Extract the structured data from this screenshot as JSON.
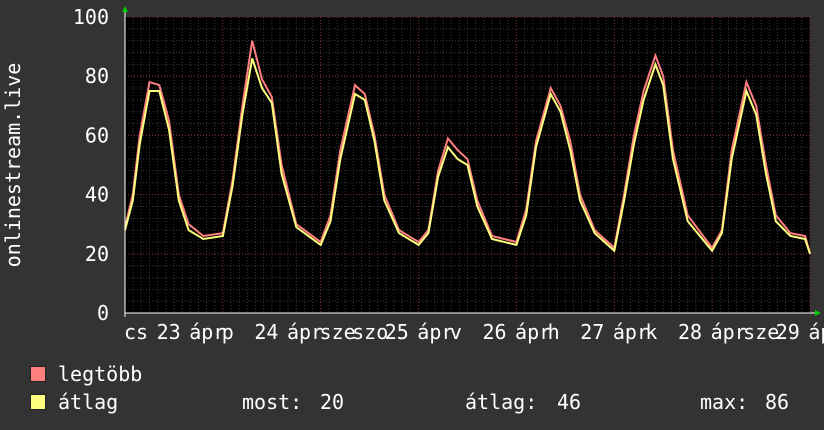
{
  "chart_data": {
    "type": "line",
    "ylabel": "onlinestream.live",
    "ylim": [
      0,
      100
    ],
    "yticks": [
      0,
      20,
      40,
      60,
      80,
      100
    ],
    "xlim": [
      0,
      7
    ],
    "xtick_labels": [
      "cs",
      "23",
      "ápr",
      "p",
      "24",
      "ápr",
      "sze",
      "szo",
      "25",
      "ápr",
      "v",
      "26",
      "ápr",
      "h",
      "27",
      "ápr",
      "k",
      "28",
      "ápr",
      "sze",
      "29",
      "ápr"
    ],
    "background": "#000000",
    "grid": true,
    "legend_position": "bottom-left",
    "series": [
      {
        "name": "legtöbb",
        "color": "#ff7f7f",
        "x": [
          0,
          0.08,
          0.15,
          0.25,
          0.35,
          0.45,
          0.55,
          0.65,
          0.8,
          1.0,
          1.1,
          1.2,
          1.3,
          1.4,
          1.5,
          1.6,
          1.75,
          2.0,
          2.1,
          2.2,
          2.35,
          2.45,
          2.55,
          2.65,
          2.8,
          3.0,
          3.1,
          3.2,
          3.3,
          3.4,
          3.5,
          3.6,
          3.75,
          4.0,
          4.1,
          4.2,
          4.35,
          4.45,
          4.55,
          4.65,
          4.8,
          5.0,
          5.1,
          5.2,
          5.3,
          5.42,
          5.5,
          5.6,
          5.75,
          6.0,
          6.1,
          6.2,
          6.35,
          6.45,
          6.55,
          6.65,
          6.8,
          6.95,
          7.0
        ],
        "values": [
          29,
          40,
          60,
          78,
          77,
          65,
          40,
          30,
          26,
          27,
          45,
          70,
          92,
          79,
          73,
          50,
          30,
          24,
          33,
          55,
          77,
          74,
          60,
          40,
          28,
          24,
          28,
          48,
          59,
          55,
          52,
          38,
          26,
          24,
          35,
          58,
          76,
          70,
          58,
          40,
          28,
          22,
          40,
          60,
          75,
          87,
          80,
          55,
          33,
          22,
          28,
          55,
          78,
          70,
          50,
          33,
          27,
          26,
          20
        ]
      },
      {
        "name": "átlag",
        "color": "#ffff7f",
        "x": [
          0,
          0.08,
          0.15,
          0.25,
          0.35,
          0.45,
          0.55,
          0.65,
          0.8,
          1.0,
          1.1,
          1.2,
          1.3,
          1.4,
          1.5,
          1.6,
          1.75,
          2.0,
          2.1,
          2.2,
          2.35,
          2.45,
          2.55,
          2.65,
          2.8,
          3.0,
          3.1,
          3.2,
          3.3,
          3.4,
          3.5,
          3.6,
          3.75,
          4.0,
          4.1,
          4.2,
          4.35,
          4.45,
          4.55,
          4.65,
          4.8,
          5.0,
          5.1,
          5.2,
          5.3,
          5.42,
          5.5,
          5.6,
          5.75,
          6.0,
          6.1,
          6.2,
          6.35,
          6.45,
          6.55,
          6.65,
          6.8,
          6.95,
          7.0
        ],
        "values": [
          28,
          38,
          57,
          75,
          75,
          62,
          38,
          28,
          25,
          26,
          43,
          67,
          86,
          76,
          71,
          47,
          29,
          23,
          31,
          52,
          74,
          72,
          58,
          38,
          27,
          23,
          27,
          46,
          56,
          52,
          50,
          36,
          25,
          23,
          33,
          56,
          74,
          68,
          55,
          38,
          27,
          21,
          38,
          57,
          72,
          84,
          77,
          52,
          31,
          21,
          27,
          52,
          75,
          67,
          47,
          31,
          26,
          25,
          20
        ]
      }
    ],
    "stats": {
      "most_label": "most:",
      "most_value": "20",
      "atlag_label": "átlag:",
      "atlag_value": "46",
      "max_label": "max:",
      "max_value": "86"
    }
  }
}
